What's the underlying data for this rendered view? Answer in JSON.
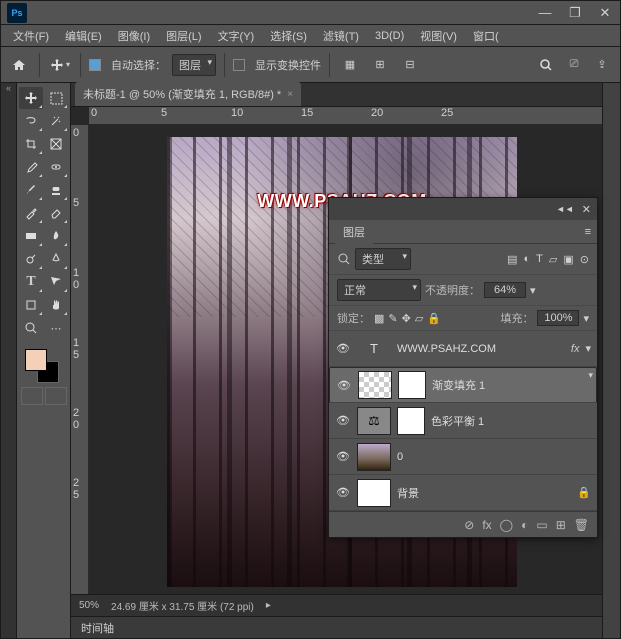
{
  "titlebar": {
    "min": "—",
    "max": "❐",
    "close": "✕"
  },
  "menu": [
    "文件(F)",
    "编辑(E)",
    "图像(I)",
    "图层(L)",
    "文字(Y)",
    "选择(S)",
    "滤镜(T)",
    "3D(D)",
    "视图(V)",
    "窗口("
  ],
  "options": {
    "auto_select_label": "自动选择：",
    "auto_select_value": "图层",
    "show_transform": "显示变换控件"
  },
  "document": {
    "tab_title": "未标题-1 @ 50% (渐变填充 1, RGB/8#) *",
    "watermark": "WWW.PSAHZ.COM"
  },
  "ruler_h": [
    "0",
    "5",
    "10",
    "15",
    "20",
    "25"
  ],
  "ruler_v": [
    "0",
    "5",
    "1 0",
    "1 5",
    "2 0",
    "2 5"
  ],
  "status": {
    "zoom": "50%",
    "dims": "24.69 厘米 x 31.75 厘米 (72 ppi)",
    "arrow": "▸"
  },
  "timeline": {
    "label": "时间轴",
    "menu": "≡"
  },
  "panel": {
    "title": "图层",
    "filter_label": "类型",
    "blend_mode": "正常",
    "opacity_label": "不透明度：",
    "opacity_value": "64%",
    "lock_label": "锁定：",
    "fill_label": "填充：",
    "fill_value": "100%",
    "layers": [
      {
        "name": "WWW.PSAHZ.COM",
        "type": "text",
        "fx": true
      },
      {
        "name": "渐变填充 1",
        "type": "gradient",
        "selected": true
      },
      {
        "name": "色彩平衡 1",
        "type": "balance"
      },
      {
        "name": "0",
        "type": "image"
      },
      {
        "name": "背景",
        "type": "bg",
        "locked": true
      }
    ]
  }
}
